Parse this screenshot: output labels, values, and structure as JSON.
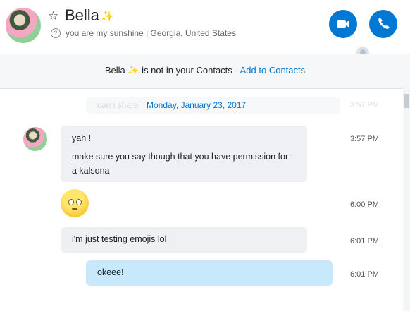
{
  "header": {
    "name": "Bella",
    "name_sparkle": "✨",
    "mood": "you are my sunshine",
    "separator": "|",
    "location": "Georgia, United States"
  },
  "banner": {
    "text": "Bella ✨ is not in your Contacts - ",
    "link": "Add to Contacts"
  },
  "chat": {
    "ghost_text": "can i share",
    "ghost_time": "3:57 PM",
    "date": "Monday, January 23, 2017",
    "messages": [
      {
        "line1": "yah !",
        "line2": "make sure you say though that you have permission for a kalsona",
        "time": "3:57 PM"
      },
      {
        "emoji": "slightly-confused-emoji",
        "time": "6:00 PM"
      },
      {
        "text": "i'm just testing emojis lol",
        "time": "6:01 PM"
      },
      {
        "text": "okeee!",
        "time": "6:01 PM"
      }
    ]
  },
  "colors": {
    "accent": "#0078d4",
    "own_bubble": "#c7e9fb",
    "other_bubble": "#eef0f3"
  }
}
